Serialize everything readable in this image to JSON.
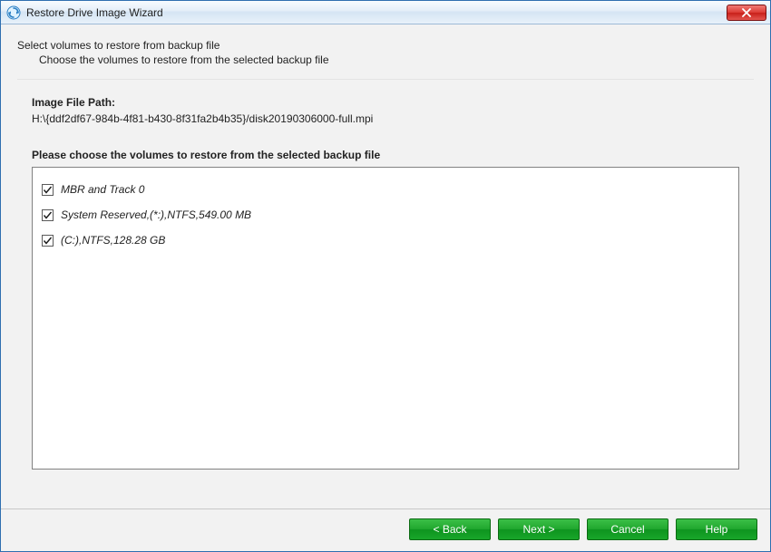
{
  "window": {
    "title": "Restore Drive Image Wizard"
  },
  "header": {
    "main": "Select volumes to restore from backup file",
    "sub": "Choose the volumes to restore from the selected backup file"
  },
  "image_file": {
    "label": "Image File Path:",
    "path": "H:\\{ddf2df67-984b-4f81-b430-8f31fa2b4b35}/disk20190306000-full.mpi"
  },
  "volumes": {
    "label": "Please choose the volumes to restore from the selected backup file",
    "items": [
      {
        "label": "MBR and Track 0",
        "checked": true
      },
      {
        "label": "System Reserved,(*:),NTFS,549.00 MB",
        "checked": true
      },
      {
        "label": "(C:),NTFS,128.28 GB",
        "checked": true
      }
    ]
  },
  "buttons": {
    "back": "< Back",
    "next": "Next >",
    "cancel": "Cancel",
    "help": "Help"
  }
}
